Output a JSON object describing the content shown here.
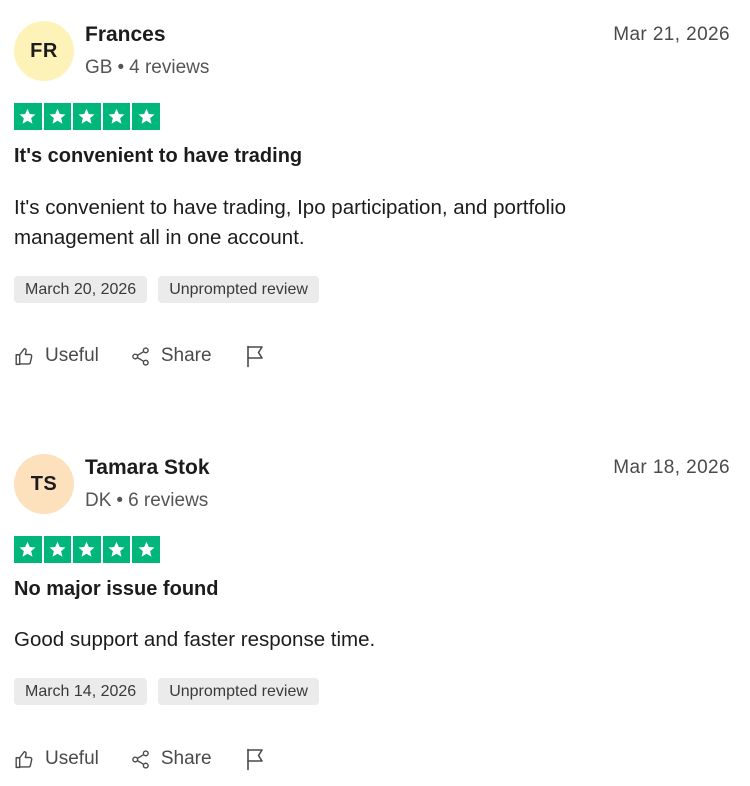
{
  "reviews": [
    {
      "initials": "FR",
      "avatar_color": "#fdf3b8",
      "name": "Frances",
      "country": "GB",
      "review_count": "4 reviews",
      "date": "Mar 21, 2026",
      "rating": 5,
      "star_color": "#00b67a",
      "title": "It's convenient to have trading",
      "body": "It's convenient to have trading, Ipo participation, and portfolio management all in one account.",
      "experience_date": "March 20, 2026",
      "tag": "Unprompted review",
      "useful_label": "Useful",
      "share_label": "Share",
      "icons": [
        "thumbs-up-icon",
        "share-icon",
        "flag-icon"
      ]
    },
    {
      "initials": "TS",
      "avatar_color": "#fde1bd",
      "name": "Tamara Stok",
      "country": "DK",
      "review_count": "6 reviews",
      "date": "Mar 18, 2026",
      "rating": 5,
      "star_color": "#00b67a",
      "title": "No major issue found",
      "body": "Good support and faster response time.",
      "experience_date": "March 14, 2026",
      "tag": "Unprompted review",
      "useful_label": "Useful",
      "share_label": "Share",
      "icons": [
        "thumbs-up-icon",
        "share-icon",
        "flag-icon"
      ]
    }
  ]
}
